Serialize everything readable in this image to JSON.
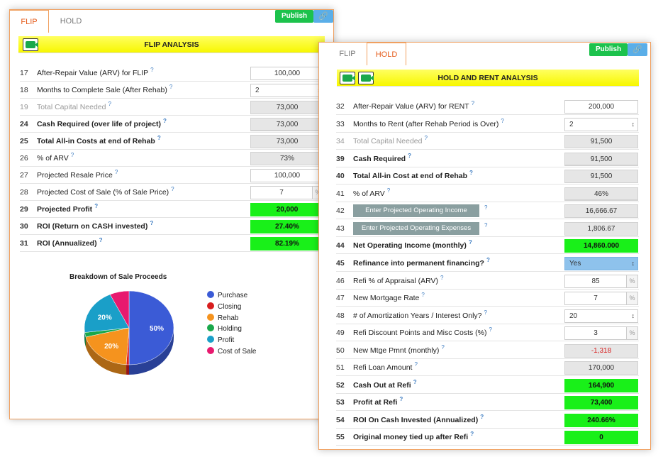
{
  "flip": {
    "tabs": [
      "FLIP",
      "HOLD"
    ],
    "publish": "Publish",
    "title": "FLIP ANALYSIS",
    "rows": [
      {
        "num": "17",
        "label": "After-Repair Value (ARV) for FLIP",
        "value": "100,000"
      },
      {
        "num": "18",
        "label": "Months to Complete Sale (After Rehab)",
        "value": "2"
      },
      {
        "num": "19",
        "label": "Total Capital Needed",
        "value": "73,000"
      },
      {
        "num": "24",
        "label": "Cash Required (over life of project)",
        "value": "73,000"
      },
      {
        "num": "25",
        "label": "Total All-in Costs at end of Rehab",
        "value": "73,000"
      },
      {
        "num": "26",
        "label": "% of ARV",
        "value": "73%"
      },
      {
        "num": "27",
        "label": "Projected Resale Price",
        "value": "100,000"
      },
      {
        "num": "28",
        "label": "Projected Cost of Sale (% of Sale Price)",
        "value": "7",
        "unit": "%"
      },
      {
        "num": "29",
        "label": "Projected Profit",
        "value": "20,000"
      },
      {
        "num": "30",
        "label": "ROI (Return on CASH invested)",
        "value": "27.40%"
      },
      {
        "num": "31",
        "label": "ROI (Annualized)",
        "value": "82.19%"
      }
    ]
  },
  "chart_data": {
    "type": "pie",
    "title": "Breakdown of Sale Proceeds",
    "categories": [
      "Purchase",
      "Closing",
      "Rehab",
      "Holding",
      "Profit",
      "Cost of Sale"
    ],
    "values": [
      50,
      1,
      20,
      2,
      20,
      7
    ],
    "data_labels": [
      "50%",
      "",
      "20%",
      "",
      "20%",
      ""
    ],
    "colors": [
      "#3b5bd6",
      "#d81e1e",
      "#f5931e",
      "#1aa84b",
      "#1a9fc8",
      "#e8196e"
    ],
    "legend_position": "right"
  },
  "hold": {
    "tabs": [
      "FLIP",
      "HOLD"
    ],
    "publish": "Publish",
    "title": "HOLD AND RENT ANALYSIS",
    "rows": [
      {
        "num": "32",
        "label": "After-Repair Value (ARV) for RENT",
        "value": "200,000"
      },
      {
        "num": "33",
        "label": "Months to Rent (after Rehab Period is Over)",
        "value": "2"
      },
      {
        "num": "34",
        "label": "Total Capital Needed",
        "value": "91,500"
      },
      {
        "num": "39",
        "label": "Cash Required",
        "value": "91,500"
      },
      {
        "num": "40",
        "label": "Total All-in Cost at end of Rehab",
        "value": "91,500"
      },
      {
        "num": "41",
        "label": "% of ARV",
        "value": "46%"
      },
      {
        "num": "42",
        "label": "Enter Projected Operating Income",
        "value": "16,666.67"
      },
      {
        "num": "43",
        "label": "Enter Projected Operating Expenses",
        "value": "1,806.67"
      },
      {
        "num": "44",
        "label": "Net Operating Income (monthly)",
        "value": "14,860.000"
      },
      {
        "num": "45",
        "label": "Refinance into permanent financing?",
        "value": "Yes"
      },
      {
        "num": "46",
        "label": "Refi % of Appraisal (ARV)",
        "value": "85",
        "unit": "%"
      },
      {
        "num": "47",
        "label": "New Mortgage Rate",
        "value": "7",
        "unit": "%"
      },
      {
        "num": "48",
        "label": "# of Amortization Years / Interest Only?",
        "value": "20"
      },
      {
        "num": "49",
        "label": "Refi Discount Points and Misc Costs (%)",
        "value": "3",
        "unit": "%"
      },
      {
        "num": "50",
        "label": "New Mtge Pmnt (monthly)",
        "value": "-1,318"
      },
      {
        "num": "51",
        "label": "Refi Loan Amount",
        "value": "170,000"
      },
      {
        "num": "52",
        "label": "Cash Out at Refi",
        "value": "164,900"
      },
      {
        "num": "53",
        "label": "Profit at Refi",
        "value": "73,400"
      },
      {
        "num": "54",
        "label": "ROI On Cash Invested (Annualized)",
        "value": "240.66%"
      },
      {
        "num": "55",
        "label": "Original money tied up after Refi",
        "value": "0"
      }
    ]
  },
  "help_mark": "?",
  "icons": {
    "link": "link-icon",
    "video": "video-camera-icon",
    "select": "up-down-arrow-icon"
  }
}
